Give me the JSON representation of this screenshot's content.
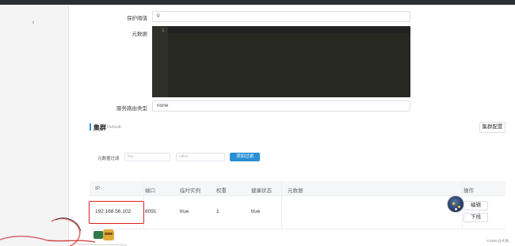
{
  "form": {
    "protect_threshold": {
      "label": "保护阈值",
      "value": "0"
    },
    "metadata": {
      "label": "元数据",
      "line_number": "1"
    },
    "service_route_type": {
      "label": "服务路由类型",
      "value": "none"
    }
  },
  "cluster": {
    "title": "集群",
    "name": "Default",
    "config_button": "集群配置"
  },
  "filter": {
    "label": "元数据过滤",
    "key_placeholder": "key",
    "value_placeholder": "value",
    "add_button": "添加过滤"
  },
  "table": {
    "headers": [
      "IP",
      "端口",
      "临时实例",
      "权重",
      "健康状态",
      "元数据",
      "操作"
    ],
    "rows": [
      {
        "ip": "192.168.56.102",
        "port": "8091",
        "ephemeral": "true",
        "weight": "1",
        "healthy": "true",
        "metadata": "",
        "edit": "编辑",
        "offline": "下线"
      }
    ]
  },
  "watermark": "CSDN @大易",
  "icons": {
    "collapse": "chevron-left-icon",
    "avatar": "user-avatar-icon"
  },
  "colors": {
    "primary": "#2a8fd4",
    "highlight": "#e02020",
    "editor_bg": "#272822"
  }
}
